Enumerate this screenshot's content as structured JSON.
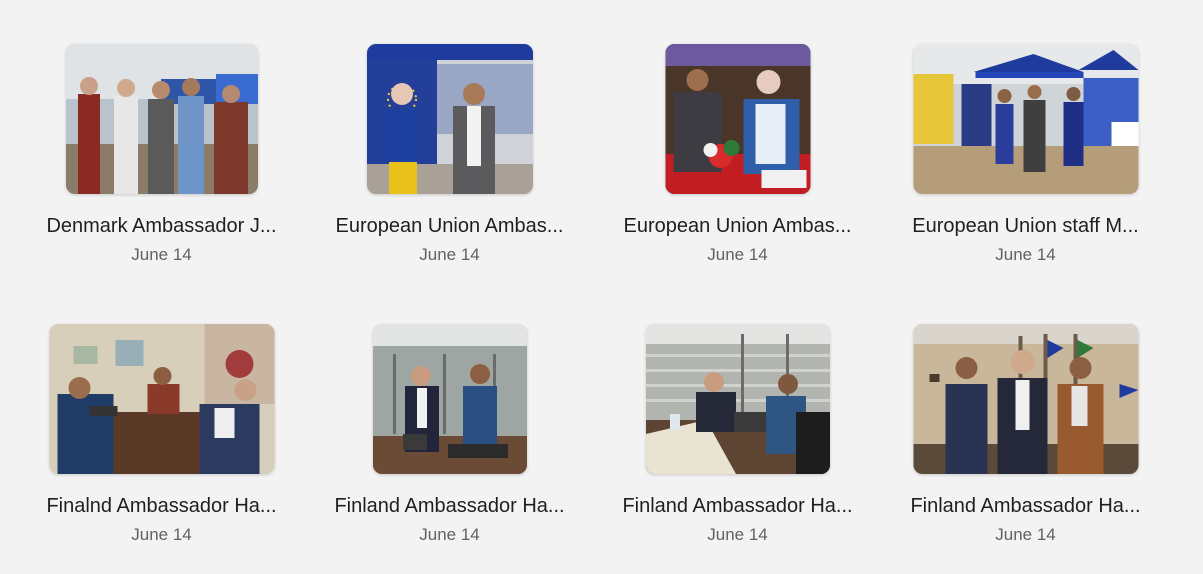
{
  "gallery": {
    "items": [
      {
        "title": "Denmark Ambassador J...",
        "date": "June 14",
        "photo": "denmark-ambassador-photo"
      },
      {
        "title": "European Union Ambas...",
        "date": "June 14",
        "photo": "eu-ambassador-booth-photo"
      },
      {
        "title": "European Union Ambas...",
        "date": "June 14",
        "photo": "eu-ambassador-dinner-photo"
      },
      {
        "title": "European Union staff M...",
        "date": "June 14",
        "photo": "eu-staff-tents-photo"
      },
      {
        "title": "Finalnd Ambassador Ha...",
        "date": "June 14",
        "photo": "finland-office-meeting-photo"
      },
      {
        "title": "Finland Ambassador Ha...",
        "date": "June 14",
        "photo": "finland-handshake-photo"
      },
      {
        "title": "Finland Ambassador Ha...",
        "date": "June 14",
        "photo": "finland-desk-meeting-photo"
      },
      {
        "title": "Finland Ambassador Ha...",
        "date": "June 14",
        "photo": "finland-group-photo"
      }
    ]
  },
  "colors": {
    "background": "#f3f3f3",
    "title_text": "#1f1f1f",
    "date_text": "#616161",
    "eu_blue": "#1f3b9e"
  }
}
